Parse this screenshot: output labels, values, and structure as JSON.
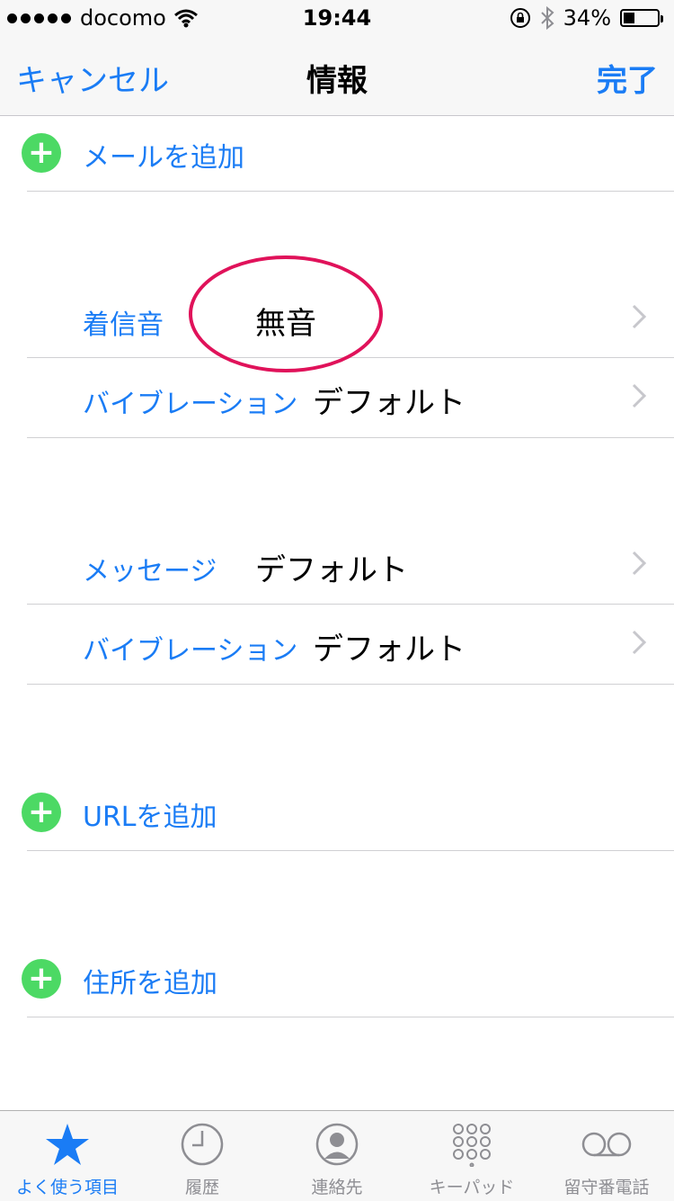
{
  "status": {
    "carrier": "docomo",
    "time": "19:44",
    "battery": "34%",
    "battery_level": 0.34
  },
  "nav": {
    "cancel": "キャンセル",
    "title": "情報",
    "done": "完了"
  },
  "add_email": "メールを追加",
  "ringtone": {
    "label": "着信音",
    "value": "無音"
  },
  "vibration1": {
    "label": "バイブレーション",
    "value": "デフォルト"
  },
  "message": {
    "label": "メッセージ",
    "value": "デフォルト"
  },
  "vibration2": {
    "label": "バイブレーション",
    "value": "デフォルト"
  },
  "add_url": "URLを追加",
  "add_address": "住所を追加",
  "tabs": [
    {
      "label": "よく使う項目",
      "icon": "star-icon",
      "active": true
    },
    {
      "label": "履歴",
      "icon": "clock-icon"
    },
    {
      "label": "連絡先",
      "icon": "contacts-icon"
    },
    {
      "label": "キーパッド",
      "icon": "keypad-icon"
    },
    {
      "label": "留守番電話",
      "icon": "voicemail-icon"
    }
  ],
  "colors": {
    "accent": "#1a7cf5",
    "add_green": "#4cd964",
    "annotation": "#e0125a"
  }
}
